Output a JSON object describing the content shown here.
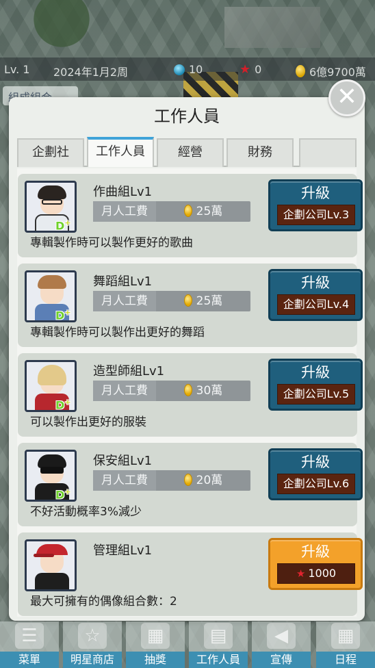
{
  "statusbar": {
    "level": "Lv. 1",
    "date": "2024年1月2周",
    "gems": "10",
    "stars": "0",
    "money": "6億9700萬"
  },
  "behind_button": "組成組合",
  "dialog": {
    "title": "工作人員",
    "close_icon": "close-icon",
    "tabs": [
      "企劃社",
      "工作人員",
      "經營",
      "財務"
    ],
    "active_tab": 1
  },
  "salary_label": "月人工費",
  "staff": [
    {
      "name": "作曲組Lv1",
      "salary": "25萬",
      "desc": "專輯製作時可以製作更好的歌曲",
      "button": "升級",
      "requirement": "企劃公司Lv.3",
      "grade": "D"
    },
    {
      "name": "舞蹈組Lv1",
      "salary": "25萬",
      "desc": "專輯製作時可以製作出更好的舞蹈",
      "button": "升級",
      "requirement": "企劃公司Lv.4",
      "grade": "D"
    },
    {
      "name": "造型師組Lv1",
      "salary": "30萬",
      "desc": "可以製作出更好的服裝",
      "button": "升級",
      "requirement": "企劃公司Lv.5",
      "grade": "D"
    },
    {
      "name": "保安組Lv1",
      "salary": "20萬",
      "desc": "不好活動概率3%減少",
      "button": "升級",
      "requirement": "企劃公司Lv.6",
      "grade": "D"
    },
    {
      "name": "管理組Lv1",
      "desc": "最大可擁有的偶像組合數：2",
      "button": "升級",
      "cost": "1000"
    }
  ],
  "bottom_nav": [
    "菜單",
    "明星商店",
    "抽獎",
    "工作人員",
    "宣傳",
    "日程"
  ],
  "colors": {
    "upgrade_blue": "#1f5f7d",
    "upgrade_orange": "#f3a12a",
    "tab_accent": "#3fa3d8",
    "nav_label": "#3d8fb2"
  }
}
